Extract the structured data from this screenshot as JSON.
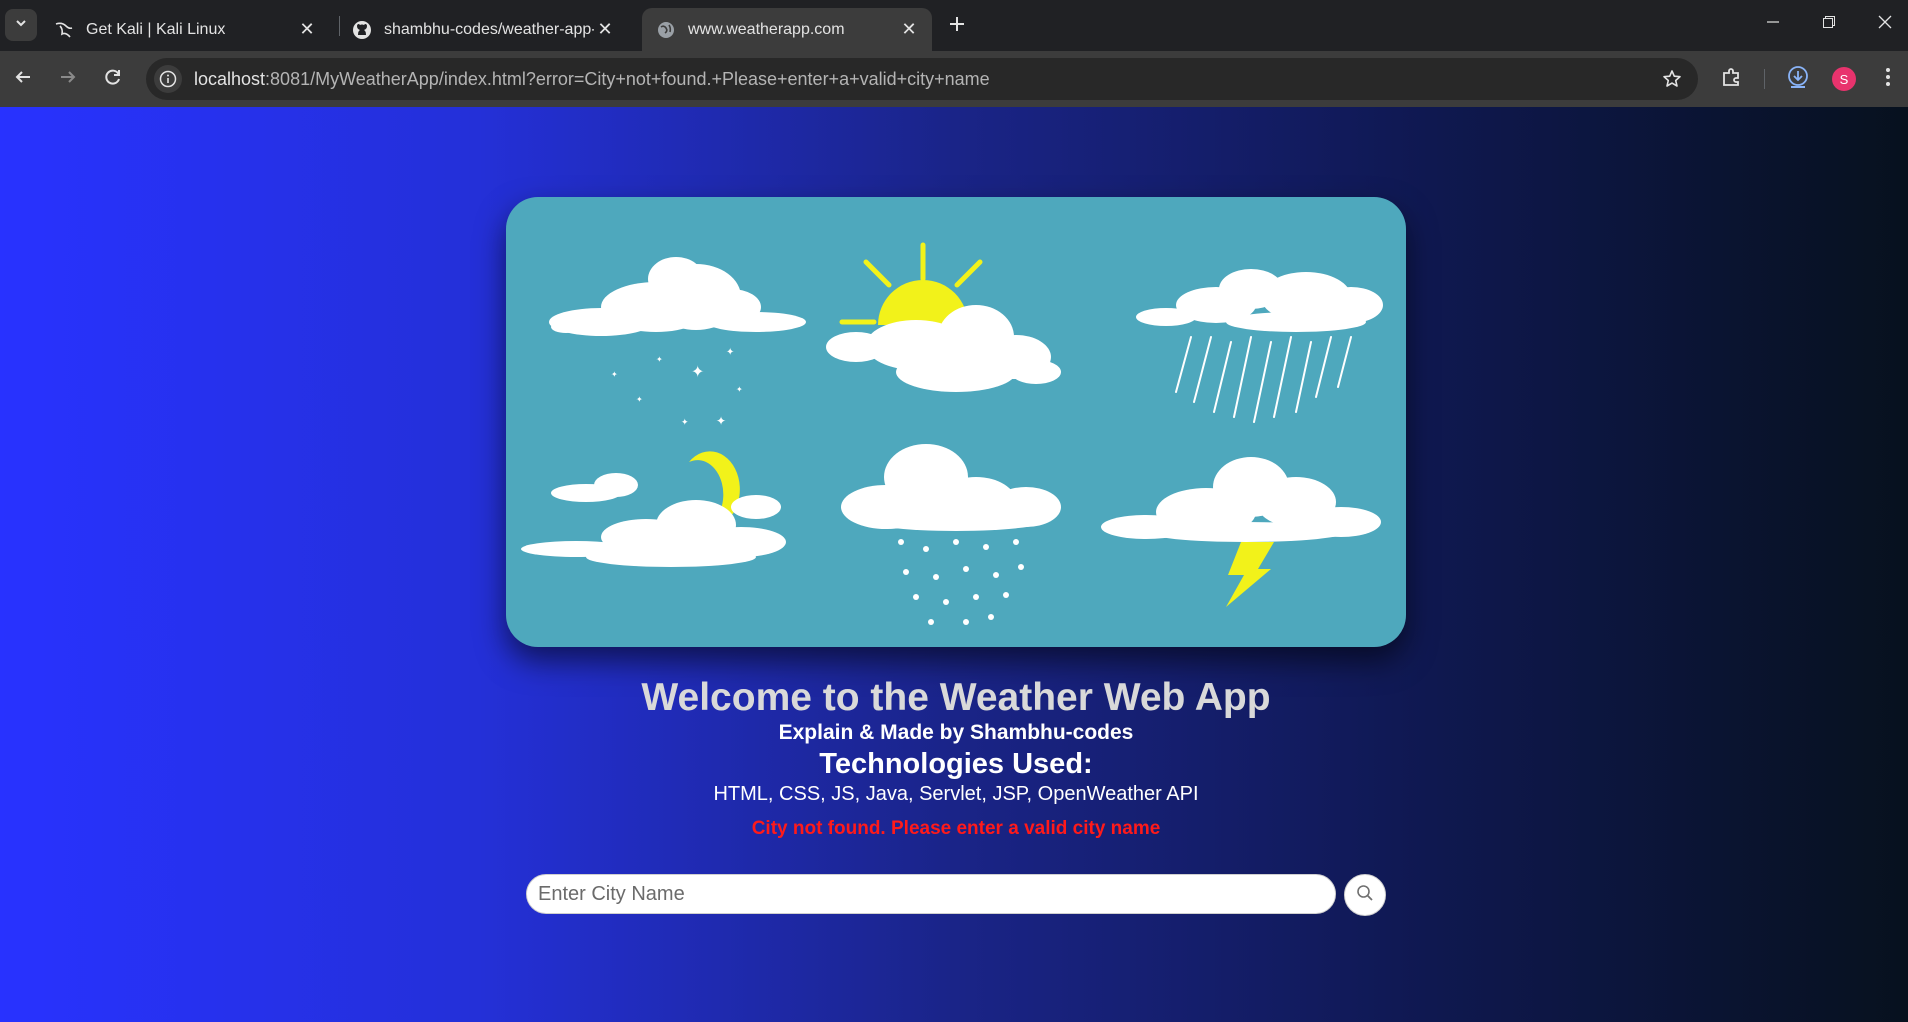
{
  "browser": {
    "tabs": [
      {
        "title": "Get Kali | Kali Linux",
        "favicon": "kali-dragon-icon"
      },
      {
        "title": "shambhu-codes/weather-app-j",
        "favicon": "github-icon"
      },
      {
        "title": "www.weatherapp.com",
        "favicon": "globe-icon"
      }
    ],
    "url_host": "localhost",
    "url_rest": ":8081/MyWeatherApp/index.html?error=City+not+found.+Please+enter+a+valid+city+name",
    "profile_initial": "S"
  },
  "page": {
    "welcome": "Welcome to the Weather Web App",
    "byline": "Explain & Made by Shambhu-codes",
    "tech_heading": "Technologies Used:",
    "tech_list": "HTML, CSS, JS, Java, Servlet, JSP, OpenWeather API",
    "error": "City not found. Please enter a valid city name",
    "search": {
      "placeholder": "Enter City Name",
      "value": ""
    }
  },
  "colors": {
    "hero_bg": "#4ea8bd",
    "sun_moon_bolt": "#f2f21a",
    "error": "#ff1a1a",
    "gradient_start": "#2832ff",
    "gradient_end": "#07111e"
  }
}
